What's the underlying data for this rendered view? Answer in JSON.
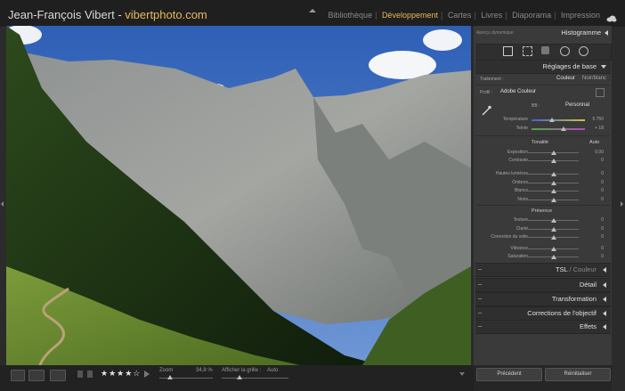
{
  "identity": {
    "name": "Jean-François Vibert - ",
    "site": "vibertphoto.com"
  },
  "modules": [
    "Bibliothèque",
    "Développement",
    "Cartes",
    "Livres",
    "Diaporama",
    "Impression"
  ],
  "active_module": "Développement",
  "right_panel": {
    "preview_label": "Aperçu dynamique",
    "histogram_title": "Histogramme",
    "basic_title": "Réglages de base",
    "treatment_label": "Traitement :",
    "treatment_color": "Couleur",
    "treatment_bw": "Noir/blanc",
    "profile_label": "Profil :",
    "profile_value": "Adobe Couleur",
    "wb_label": "BB :",
    "wb_value": "Personnal",
    "temp_label": "Température",
    "temp_value": "5 750",
    "tint_label": "Teinte",
    "tint_value": "+ 18",
    "tone_label": "Tonalité",
    "auto_label": "Auto",
    "tone_sliders": [
      {
        "label": "Exposition",
        "value": "0,00",
        "pos": 0.5
      },
      {
        "label": "Contraste",
        "value": "0",
        "pos": 0.5
      },
      {
        "label": "Hautes lumières",
        "value": "0",
        "pos": 0.5
      },
      {
        "label": "Ombres",
        "value": "0",
        "pos": 0.5
      },
      {
        "label": "Blancs",
        "value": "0",
        "pos": 0.5
      },
      {
        "label": "Noirs",
        "value": "0",
        "pos": 0.5
      }
    ],
    "presence_label": "Présence",
    "presence_sliders": [
      {
        "label": "Texture",
        "value": "0",
        "pos": 0.5
      },
      {
        "label": "Clarté",
        "value": "0",
        "pos": 0.5
      },
      {
        "label": "Correction du voile",
        "value": "0",
        "pos": 0.5
      },
      {
        "label": "Vibrance",
        "value": "0",
        "pos": 0.5
      },
      {
        "label": "Saturation",
        "value": "0",
        "pos": 0.5
      }
    ],
    "collapsed_panels": [
      "TSL / Couleur",
      "Détail",
      "Transformation",
      "Corrections de l'objectif",
      "Effets"
    ],
    "tsl_main": "TSL",
    "tsl_sep": " / ",
    "tsl_sub": "Couleur"
  },
  "toolbar": {
    "rating_stars": 4,
    "zoom_label": "Zoom",
    "zoom_value": "34,8 %",
    "grid_label": "Afficher la grille :",
    "grid_value": "Auto"
  },
  "buttons": {
    "previous": "Précédent",
    "reset": "Réinitialiser"
  },
  "colors": {
    "accent": "#e8b95a"
  }
}
